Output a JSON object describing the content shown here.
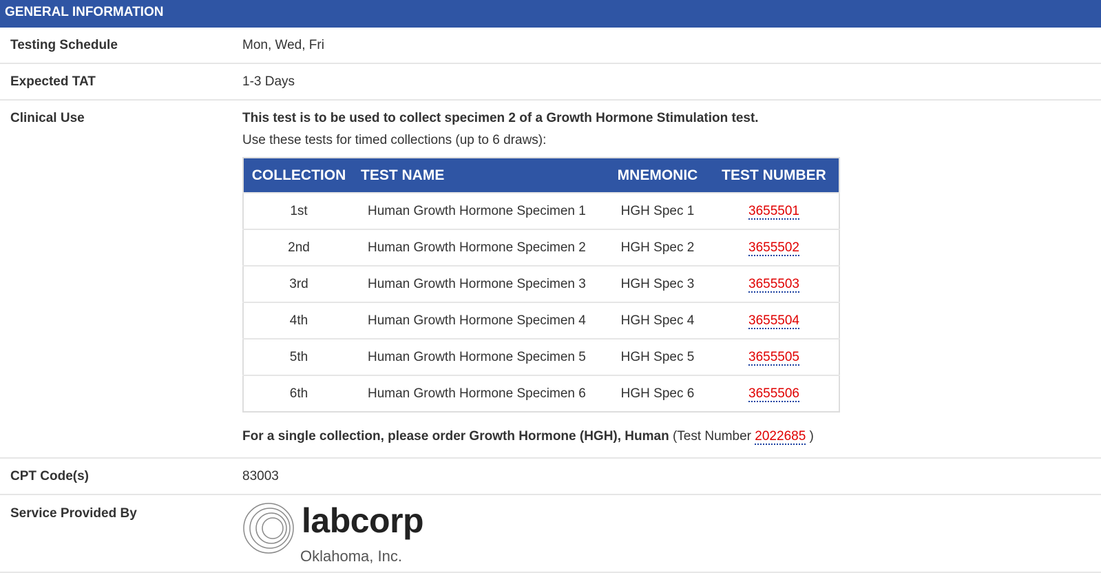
{
  "section": {
    "title": "GENERAL INFORMATION"
  },
  "rows": {
    "testing_schedule": {
      "label": "Testing Schedule",
      "value": "Mon, Wed, Fri"
    },
    "expected_tat": {
      "label": "Expected TAT",
      "value": "1-3 Days"
    },
    "clinical_use": {
      "label": "Clinical Use",
      "bold_text": "This test is to be used to collect specimen 2 of a Growth Hormone Stimulation test.",
      "normal_text": "Use these tests for timed collections (up to 6 draws):"
    },
    "cpt_codes": {
      "label": "CPT Code(s)",
      "value": "83003"
    },
    "service_provided_by": {
      "label": "Service Provided By"
    }
  },
  "collection_table": {
    "headers": {
      "collection": "COLLECTION",
      "test_name": "TEST NAME",
      "mnemonic": "MNEMONIC",
      "test_number": "TEST NUMBER"
    },
    "rows": [
      {
        "collection": "1st",
        "test_name": "Human Growth Hormone Specimen 1",
        "mnemonic": "HGH Spec 1",
        "test_number": "3655501"
      },
      {
        "collection": "2nd",
        "test_name": "Human Growth Hormone Specimen 2",
        "mnemonic": "HGH Spec 2",
        "test_number": "3655502"
      },
      {
        "collection": "3rd",
        "test_name": "Human Growth Hormone Specimen 3",
        "mnemonic": "HGH Spec 3",
        "test_number": "3655503"
      },
      {
        "collection": "4th",
        "test_name": "Human Growth Hormone Specimen 4",
        "mnemonic": "HGH Spec 4",
        "test_number": "3655504"
      },
      {
        "collection": "5th",
        "test_name": "Human Growth Hormone Specimen 5",
        "mnemonic": "HGH Spec 5",
        "test_number": "3655505"
      },
      {
        "collection": "6th",
        "test_name": "Human Growth Hormone Specimen 6",
        "mnemonic": "HGH Spec 6",
        "test_number": "3655506"
      }
    ]
  },
  "single_collection": {
    "bold_text": "For a single collection, please order Growth Hormone (HGH), Human",
    "prefix": " (Test Number ",
    "test_number": "2022685",
    "suffix": " )"
  },
  "logo": {
    "name": "labcorp",
    "subtitle": "Oklahoma, Inc.",
    "icon": "labcorp-rings-icon"
  },
  "colors": {
    "header_bg": "#2f55a4",
    "link": "#e00000",
    "link_underline": "#1a3fa0",
    "row_border": "#e6e6e6"
  }
}
